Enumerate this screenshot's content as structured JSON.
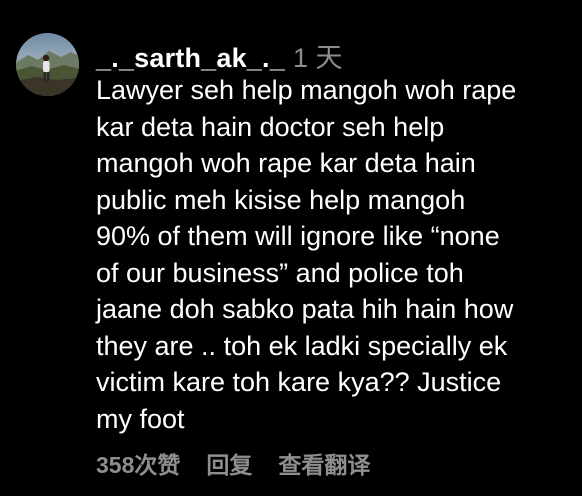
{
  "comment": {
    "username": "_._sarth_ak_._",
    "time": "1 天",
    "body_lines": [
      "Lawyer seh help mangoh woh rape",
      "kar deta hain doctor seh help",
      "mangoh woh rape kar deta hain",
      "public meh kisise help mangoh",
      "90% of them will ignore like “none",
      "of our business” and police toh",
      "jaane doh sabko pata hih hain how",
      "they are .. toh ek ladki specially ek",
      "victim kare toh kare kya?? Justice",
      "my foot"
    ]
  },
  "actions": {
    "likes": "358次赞",
    "reply": "回复",
    "translate": "查看翻译"
  },
  "colors": {
    "background": "#000000",
    "text": "#ffffff",
    "secondary": "#8e8e8e"
  },
  "icons": {
    "avatar": "profile-photo-mountain"
  }
}
